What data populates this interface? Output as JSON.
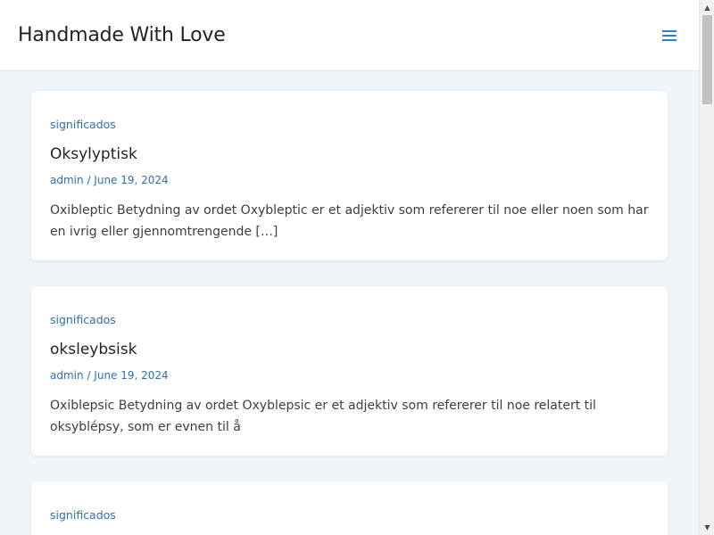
{
  "header": {
    "site_title": "Handmade With Love",
    "menu_icon": "hamburger-menu-icon"
  },
  "posts": [
    {
      "category": "significados",
      "title": "Oksylyptisk",
      "author": "admin",
      "separator": "/",
      "date": "June 19, 2024",
      "excerpt": "Oxibleptic Betydning av ordet Oxybleptic er et adjektiv som refererer til noe eller noen som har en ivrig eller gjennomtrengende […]"
    },
    {
      "category": "significados",
      "title": "oksleybsisk",
      "author": "admin",
      "separator": "/",
      "date": "June 19, 2024",
      "excerpt": "Oxiblepsic Betydning av ordet Oxyblepsic er et adjektiv som refererer til noe relatert til oksyblépsy, som er evnen til å"
    },
    {
      "category": "significados"
    }
  ],
  "scrollbar": {
    "up_arrow": "▲",
    "down_arrow": "▼"
  },
  "colors": {
    "accent": "#2f6fb0",
    "page_background": "#f0f5fa",
    "card_background": "#ffffff",
    "text": "#1e2227"
  }
}
